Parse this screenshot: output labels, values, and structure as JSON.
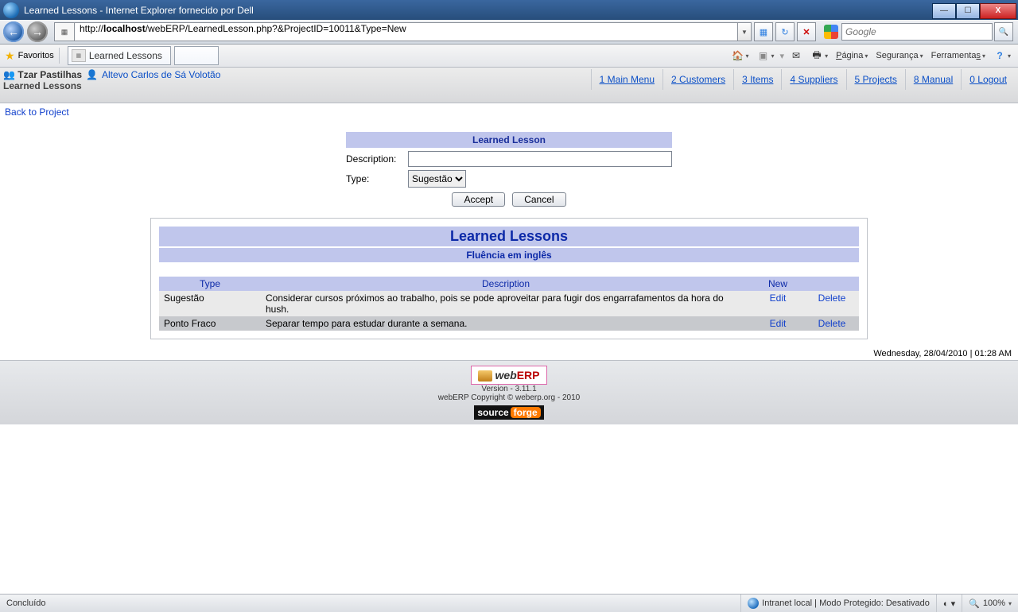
{
  "window": {
    "title": "Learned Lessons - Internet Explorer fornecido por Dell"
  },
  "nav": {
    "url_pre": "http://",
    "url_host": "localhost",
    "url_path": "/webERP/LearnedLesson.php?&ProjectID=10011&Type=New",
    "search_placeholder": "Google"
  },
  "favbar": {
    "favorites": "Favoritos",
    "tab_label": "Learned Lessons"
  },
  "cmd": {
    "page": "Página",
    "safety": "Segurança",
    "tools": "Ferramentas"
  },
  "header": {
    "company": "Tzar Pastilhas",
    "user": "Altevo Carlos de Sá Volotão",
    "pagename": "Learned Lessons",
    "menu": [
      {
        "n": "1",
        "t": "Main Menu"
      },
      {
        "n": "2",
        "t": "Customers"
      },
      {
        "n": "3",
        "t": "Items"
      },
      {
        "n": "4",
        "t": "Suppliers"
      },
      {
        "n": "5",
        "t": "Projects"
      },
      {
        "n": "8",
        "t": "Manual"
      },
      {
        "n": "0",
        "t": "Logout"
      }
    ]
  },
  "backlink": "Back to Project",
  "form": {
    "title": "Learned Lesson",
    "desc_label": "Description:",
    "type_label": "Type:",
    "type_value": "Sugestão",
    "accept": "Accept",
    "cancel": "Cancel"
  },
  "panel": {
    "title": "Learned Lessons",
    "subtitle": "Fluência em inglês",
    "th_type": "Type",
    "th_desc": "Description",
    "th_new": "New",
    "edit": "Edit",
    "delete": "Delete",
    "rows": [
      {
        "type": "Sugestão",
        "desc": "Considerar cursos próximos ao trabalho, pois se pode aproveitar para fugir dos engarrafamentos da hora do hush."
      },
      {
        "type": "Ponto Fraco",
        "desc": "Separar tempo para estudar durante a semana."
      }
    ]
  },
  "timestamp": "Wednesday, 28/04/2010 | 01:28 AM",
  "footer": {
    "version": "Version - 3.11.1",
    "copyright": "webERP Copyright © weberp.org - 2010"
  },
  "status": {
    "done": "Concluído",
    "zone": "Intranet local | Modo Protegido: Desativado",
    "zoom": "100%"
  }
}
